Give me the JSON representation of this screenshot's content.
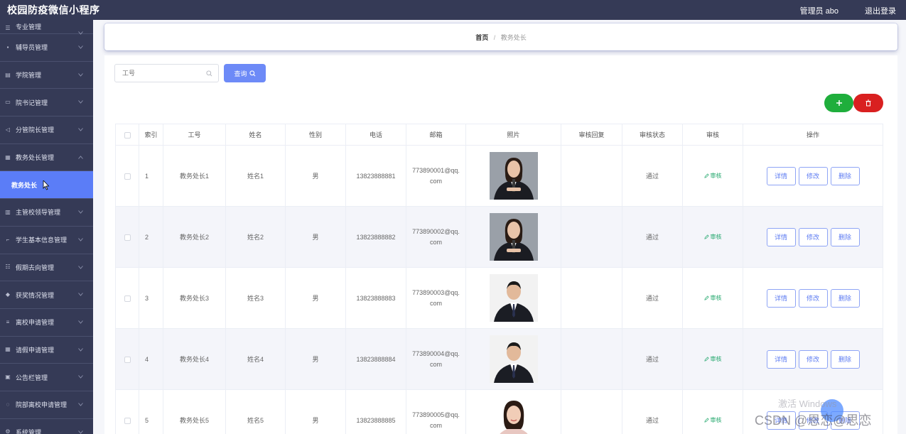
{
  "app_title": "校园防疫微信小程序",
  "header": {
    "user": "管理员 abo",
    "logout": "退出登录"
  },
  "sidebar": {
    "items": [
      {
        "label": "专业管理",
        "icon": "menu-icon"
      },
      {
        "label": "辅导员管理",
        "icon": "briefcase-icon"
      },
      {
        "label": "学院管理",
        "icon": "building-icon"
      },
      {
        "label": "院书记管理",
        "icon": "id-card-icon"
      },
      {
        "label": "分管院长管理",
        "icon": "send-icon"
      },
      {
        "label": "教务处长管理",
        "icon": "grid-icon"
      },
      {
        "label": "教务处长",
        "icon": ""
      },
      {
        "label": "主管校领导管理",
        "icon": "document-icon"
      },
      {
        "label": "学生基本信息管理",
        "icon": "crop-icon"
      },
      {
        "label": "假期去向管理",
        "icon": "sliders-icon"
      },
      {
        "label": "获奖情况管理",
        "icon": "award-icon"
      },
      {
        "label": "离校申请管理",
        "icon": "list-icon"
      },
      {
        "label": "请假申请管理",
        "icon": "table-icon"
      },
      {
        "label": "公告栏管理",
        "icon": "clipboard-icon"
      },
      {
        "label": "院部离校申请管理",
        "icon": "power-icon"
      },
      {
        "label": "系统管理",
        "icon": "gear-icon"
      }
    ]
  },
  "breadcrumb": {
    "home": "首页",
    "separator": "/",
    "current": "教务处长"
  },
  "search": {
    "placeholder": "工号",
    "value": "",
    "button": "查询"
  },
  "table": {
    "headers": [
      "",
      "索引",
      "工号",
      "姓名",
      "性别",
      "电话",
      "邮箱",
      "照片",
      "审核回复",
      "审核状态",
      "审核",
      "操作"
    ],
    "rows": [
      {
        "index": "1",
        "id": "教务处长1",
        "name": "姓名1",
        "gender": "男",
        "phone": "13823888881",
        "email": "773890001@qq.com",
        "reply": "",
        "status": "通过",
        "audit": "审核",
        "photo": "female"
      },
      {
        "index": "2",
        "id": "教务处长2",
        "name": "姓名2",
        "gender": "男",
        "phone": "13823888882",
        "email": "773890002@qq.com",
        "reply": "",
        "status": "通过",
        "audit": "审核",
        "photo": "female"
      },
      {
        "index": "3",
        "id": "教务处长3",
        "name": "姓名3",
        "gender": "男",
        "phone": "13823888883",
        "email": "773890003@qq.com",
        "reply": "",
        "status": "通过",
        "audit": "审核",
        "photo": "male"
      },
      {
        "index": "4",
        "id": "教务处长4",
        "name": "姓名4",
        "gender": "男",
        "phone": "13823888884",
        "email": "773890004@qq.com",
        "reply": "",
        "status": "通过",
        "audit": "审核",
        "photo": "male"
      },
      {
        "index": "5",
        "id": "教务处长5",
        "name": "姓名5",
        "gender": "男",
        "phone": "13823888885",
        "email": "773890005@qq.com",
        "reply": "",
        "status": "通过",
        "audit": "审核",
        "photo": "female-light"
      }
    ],
    "actions": {
      "detail": "详情",
      "edit": "修改",
      "delete": "删除"
    }
  },
  "overlay": {
    "watermark": "激活 Windows",
    "csdn": "CSDN @恩恋@思恋"
  },
  "colors": {
    "sidebar": "#353a56",
    "primary": "#6d8af7",
    "active": "#5b7df7",
    "add": "#1fae3c",
    "delete": "#d92020",
    "audit": "#1fa66a"
  }
}
